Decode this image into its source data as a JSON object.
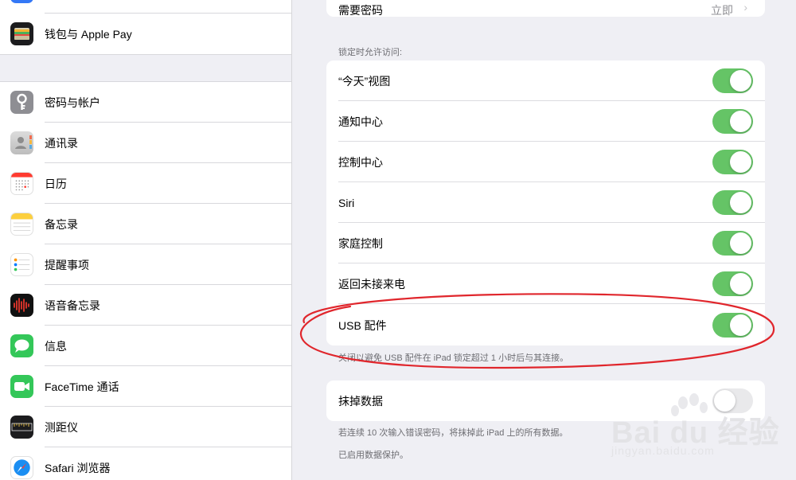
{
  "sidebar": {
    "items": [
      {
        "label": "钱包与 Apple Pay",
        "icon": "wallet-icon"
      },
      {
        "label": "密码与帐户",
        "icon": "key-icon"
      },
      {
        "label": "通讯录",
        "icon": "contacts-icon"
      },
      {
        "label": "日历",
        "icon": "calendar-icon"
      },
      {
        "label": "备忘录",
        "icon": "notes-icon"
      },
      {
        "label": "提醒事项",
        "icon": "reminders-icon"
      },
      {
        "label": "语音备忘录",
        "icon": "voice-memos-icon"
      },
      {
        "label": "信息",
        "icon": "messages-icon"
      },
      {
        "label": "FaceTime 通话",
        "icon": "facetime-icon"
      },
      {
        "label": "测距仪",
        "icon": "measure-icon"
      },
      {
        "label": "Safari 浏览器",
        "icon": "safari-icon"
      }
    ]
  },
  "main": {
    "top_partial_label": "需要密码",
    "top_partial_value": "立即",
    "lock_access_header": "锁定时允许访问:",
    "lock_access_rows": [
      {
        "label": "“今天”视图",
        "on": true
      },
      {
        "label": "通知中心",
        "on": true
      },
      {
        "label": "控制中心",
        "on": true
      },
      {
        "label": "Siri",
        "on": true
      },
      {
        "label": "家庭控制",
        "on": true
      },
      {
        "label": "返回未接来电",
        "on": true
      },
      {
        "label": "USB 配件",
        "on": true
      }
    ],
    "usb_footnote": "关闭以避免 USB 配件在 iPad 锁定超过 1 小时后与其连接。",
    "erase_data_label": "抹掉数据",
    "erase_data_on": false,
    "erase_footnote": "若连续 10 次输入错误密码，将抹掉此 iPad 上的所有数据。",
    "protection_footnote": "已启用数据保护。"
  },
  "watermark": {
    "brand": "Bai du 经验",
    "url": "jingyan.baidu.com"
  },
  "colors": {
    "toggle_on": "#65c466",
    "toggle_off": "#e9e9eb",
    "annotation_red": "#e0262c",
    "background_grouped": "#efeff4"
  }
}
